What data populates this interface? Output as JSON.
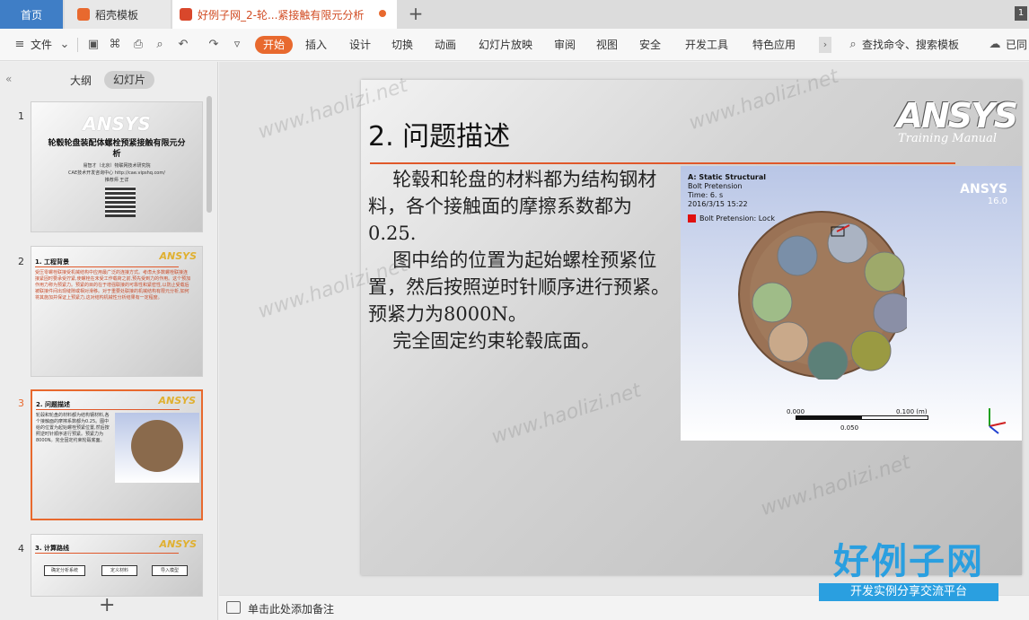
{
  "tabs": {
    "home": "首页",
    "templates": "稻壳模板",
    "doc": "好例子网_2-轮...紧接触有限元分析",
    "badge": "1"
  },
  "toolbar": {
    "file": "文件",
    "start": "开始",
    "items": [
      "插入",
      "设计",
      "切换",
      "动画",
      "幻灯片放映",
      "审阅",
      "视图",
      "安全",
      "开发工具",
      "特色应用"
    ],
    "search": "查找命令、搜索模板",
    "sync": "已同"
  },
  "left_panel": {
    "outline": "大纲",
    "slides": "幻灯片",
    "thumbnails": [
      {
        "num": "1",
        "logo": "ANSYS",
        "title": "轮毂轮盘装配体螺栓预紧接触有限元分析",
        "lines": [
          "易智才（北京）物联网技术研究院",
          "CAE技术开发咨询中心 http://cae.vipshq.com/",
          "推荐师 王详"
        ]
      },
      {
        "num": "2",
        "logo": "ANSYS",
        "title": "1. 工程背景",
        "text": "受压零螺栓联接受机械结构中应用最广泛的连接方式。考虑大多数螺栓联接连接紧固时要承受拧紧,使螺栓在未受工作载荷之前,预先受到力的作用。这个预加作用力称为预紧力。预紧的目的在于增强联接的可靠性和紧密性,以防止受载后被联接件间出现缝隙或相对滑移。对于重要处联接的机械结构有限元分析,如何将其施加并保证上预紧力,这对结构机械性分析结果有一定程度。"
      },
      {
        "num": "3",
        "logo": "ANSYS",
        "title": "2. 问题描述",
        "text": "轮毂和轮盘的材料都为结构钢材料,各个接触面的摩擦系数都为0.25。图中给的位置为起始螺栓预紧位置,然后按照逆时针顺序进行预紧。预紧力为8000N。完全固定约束轮毂底面。"
      },
      {
        "num": "4",
        "logo": "ANSYS",
        "title": "3. 计算路线",
        "flow": [
          "确定分析系统",
          "定义材料",
          "导入模型"
        ]
      }
    ]
  },
  "slide": {
    "title": "2. 问题描述",
    "logo": "ANSYS",
    "logo_sub": "Training Manual",
    "paragraphs": [
      "轮毂和轮盘的材料都为结构钢材料，各个接触面的摩擦系数都为0.25.",
      "图中给的位置为起始螺栓预紧位置，然后按照逆时针顺序进行预紧。预紧力为8000N。",
      "完全固定约束轮毂底面。"
    ],
    "figure": {
      "header": [
        "A: Static Structural",
        "Bolt Pretension",
        "Time: 6. s",
        "2016/3/15 15:22"
      ],
      "legend": "Bolt Pretension: Lock",
      "brand": "ANSYS",
      "version": "16.0",
      "scale_labels": [
        "0.000",
        "0.100 (m)",
        "0.050"
      ]
    }
  },
  "notes": {
    "placeholder": "单击此处添加备注"
  },
  "watermark": {
    "text": "www.haolizi.net",
    "brand": "好例子网",
    "tagline": "开发实例分享交流平台"
  }
}
